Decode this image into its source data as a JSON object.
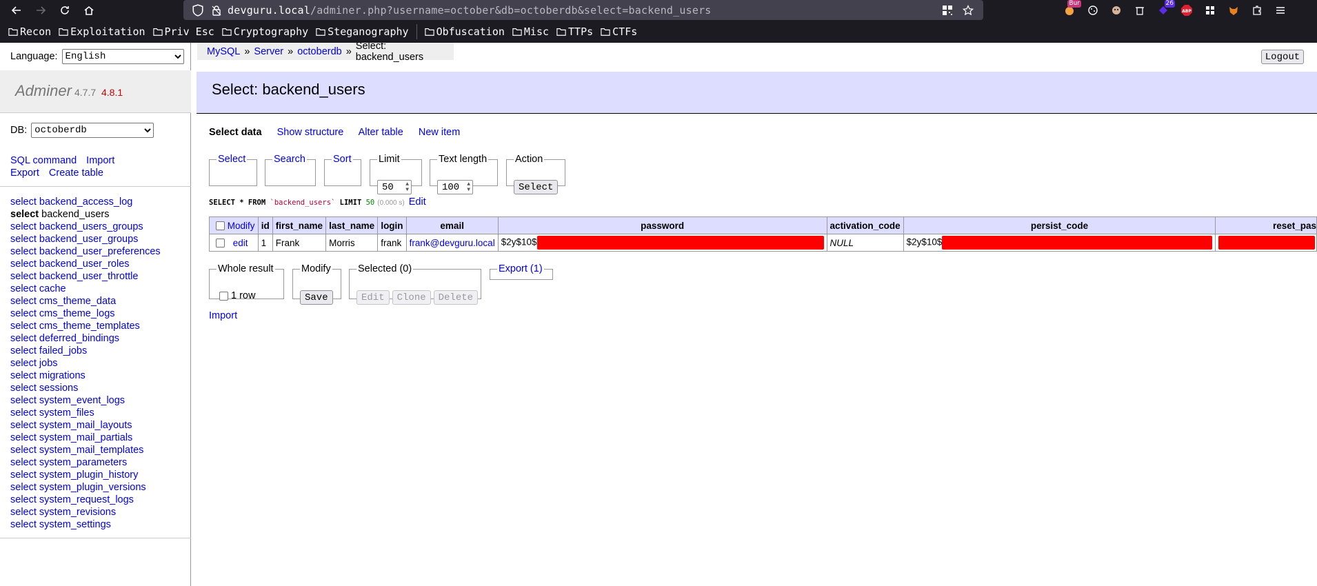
{
  "browser": {
    "url_host": "devguru.local",
    "url_path": "/adminer.php?username=october&db=octoberdb&select=backend_users",
    "bookmarks": [
      "Recon",
      "Exploitation",
      "Priv Esc",
      "Cryptography",
      "Steganography",
      "Obfuscation",
      "Misc",
      "TTPs",
      "CTFs"
    ],
    "ext_badges": {
      "burp": "Bur",
      "count": "26",
      "abp": "ABP"
    }
  },
  "menu": {
    "language_label": "Language:",
    "language_value": "English",
    "app_name": "Adminer",
    "version": "4.7.7",
    "new_version": "4.8.1",
    "db_label": "DB:",
    "db_value": "octoberdb",
    "links": [
      "SQL command",
      "Import",
      "Export",
      "Create table"
    ],
    "select_word": "select",
    "tables": [
      "backend_access_log",
      "backend_users",
      "backend_users_groups",
      "backend_user_groups",
      "backend_user_preferences",
      "backend_user_roles",
      "backend_user_throttle",
      "cache",
      "cms_theme_data",
      "cms_theme_logs",
      "cms_theme_templates",
      "deferred_bindings",
      "failed_jobs",
      "jobs",
      "migrations",
      "sessions",
      "system_event_logs",
      "system_files",
      "system_mail_layouts",
      "system_mail_partials",
      "system_mail_templates",
      "system_parameters",
      "system_plugin_history",
      "system_plugin_versions",
      "system_request_logs",
      "system_revisions",
      "system_settings"
    ],
    "active_table": "backend_users"
  },
  "breadcrumb": {
    "items": [
      "MySQL",
      "Server",
      "octoberdb"
    ],
    "current": "Select: backend_users",
    "separator": "»"
  },
  "logout_label": "Logout",
  "title": "Select: backend_users",
  "subnav": [
    "Select data",
    "Show structure",
    "Alter table",
    "New item"
  ],
  "filters": {
    "select": "Select",
    "search": "Search",
    "sort": "Sort",
    "limit_label": "Limit",
    "limit_value": "50",
    "textlen_label": "Text length",
    "textlen_value": "100",
    "action_label": "Action",
    "action_button": "Select"
  },
  "query": {
    "prefix": "SELECT * FROM ",
    "table": "`backend_users`",
    "limit_kw": " LIMIT ",
    "limit": "50",
    "time": "(0.000 s)",
    "edit": "Edit"
  },
  "table": {
    "modify_header": "Modify",
    "columns": [
      "id",
      "first_name",
      "last_name",
      "login",
      "email",
      "password",
      "activation_code",
      "persist_code",
      "reset_pas"
    ],
    "row": {
      "edit": "edit",
      "id": "1",
      "first_name": "Frank",
      "last_name": "Morris",
      "login": "frank",
      "email": "frank@devguru.local",
      "password_prefix": "$2y$10$",
      "activation_code": "NULL",
      "persist_prefix": "$2y$10$"
    }
  },
  "bottom": {
    "whole_result": "Whole result",
    "rows": "1 row",
    "modify": "Modify",
    "save": "Save",
    "selected": "Selected (0)",
    "edit": "Edit",
    "clone": "Clone",
    "delete": "Delete",
    "export": "Export (1)",
    "import": "Import"
  },
  "colors": {
    "header_bg": "#ddf",
    "redaction": "#ff0000",
    "link": "#0000ee",
    "new_version": "#cc0000"
  }
}
